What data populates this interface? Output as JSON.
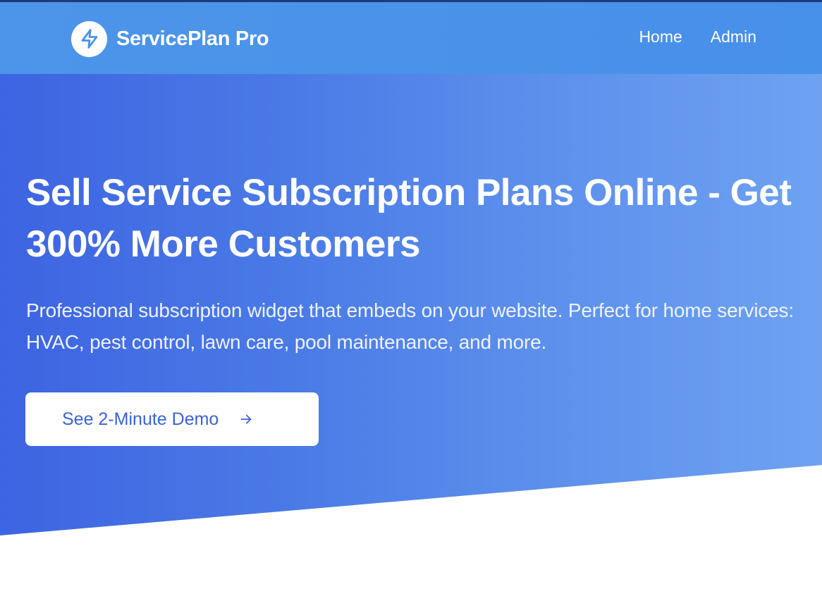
{
  "colors": {
    "navbar": "#4a91ea",
    "hero_start": "#3d64e2",
    "hero_end": "#6ea2f1",
    "button_text": "#3a63d6",
    "white": "#ffffff"
  },
  "header": {
    "brand_name": "ServicePlan Pro",
    "logo_icon": "lightning-bolt-icon",
    "nav": [
      {
        "label": "Home"
      },
      {
        "label": "Admin"
      }
    ]
  },
  "hero": {
    "title": "Sell Service Subscription Plans Online - Get 300% More Customers",
    "subtitle": "Professional subscription widget that embeds on your website. Perfect for home services: HVAC, pest control, lawn care, pool maintenance, and more.",
    "cta": {
      "label": "See 2-Minute Demo",
      "icon": "arrow-right-icon"
    }
  }
}
